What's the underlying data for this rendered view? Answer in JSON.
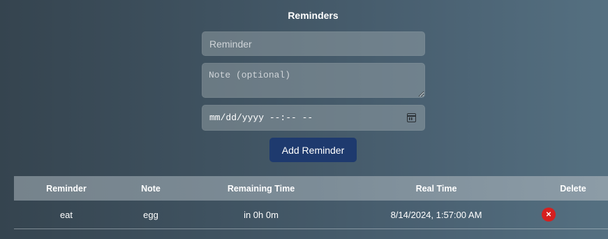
{
  "page": {
    "title": "Reminders"
  },
  "form": {
    "reminder_placeholder": "Reminder",
    "note_placeholder": "Note (optional)",
    "datetime_placeholder": "mm/dd/yyyy --:-- --",
    "add_label": "Add Reminder"
  },
  "table": {
    "headers": [
      "Reminder",
      "Note",
      "Remaining Time",
      "Real Time",
      "Delete"
    ],
    "rows": [
      {
        "reminder": "eat",
        "note": "egg",
        "remaining": "in 0h 0m",
        "real_time": "8/14/2024, 1:57:00 AM",
        "delete_glyph": "✕"
      }
    ]
  },
  "icons": {
    "calendar": "calendar-icon",
    "delete": "close-icon"
  },
  "colors": {
    "add_button": "#1e3a6e",
    "delete_button": "#d61f1f"
  }
}
